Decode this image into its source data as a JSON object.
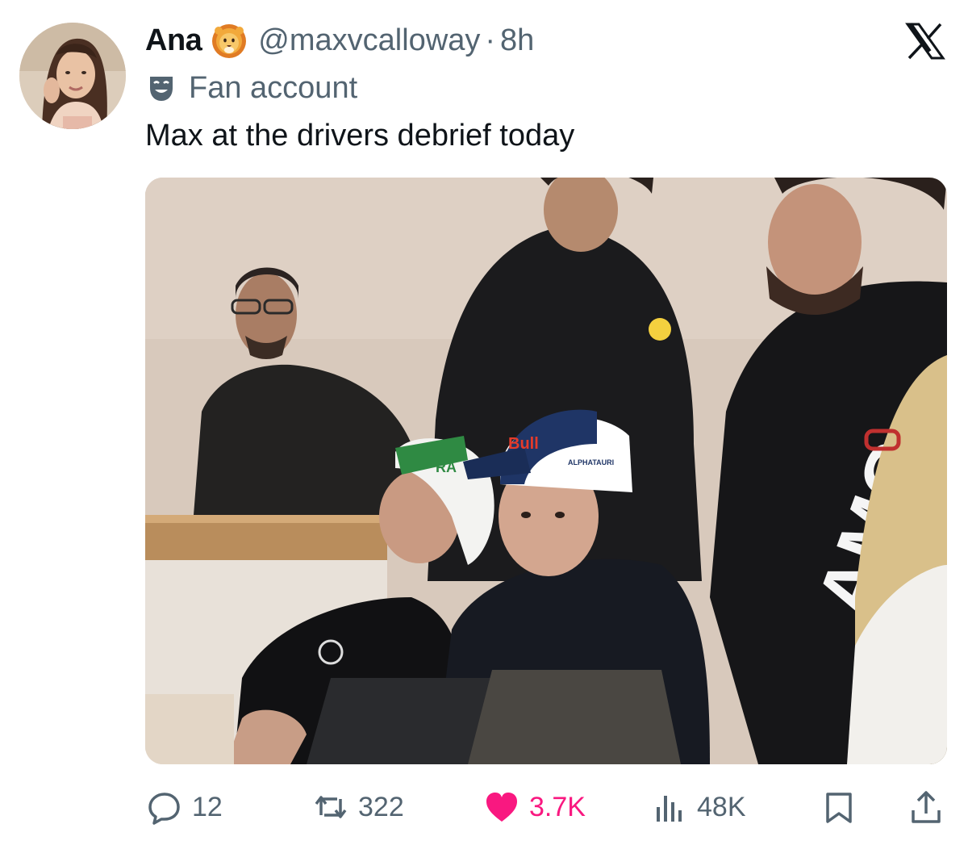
{
  "tweet": {
    "display_name": "Ana",
    "name_emoji": "lion-face-icon",
    "handle": "@maxvcalloway",
    "separator": "·",
    "time": "8h",
    "label_icon": "performing-arts-mask-icon",
    "label": "Fan account",
    "text": "Max at the drivers debrief today",
    "media_alt_icon": "photo",
    "media_caps": {
      "white_cap": "RA",
      "blue_cap_brand": "Bull",
      "blue_cap_team": "ALPHATAURI",
      "hoodie_logo": "AMG"
    }
  },
  "actions": {
    "reply": {
      "icon": "reply-bubble-icon",
      "count": "12"
    },
    "repost": {
      "icon": "repost-icon",
      "count": "322"
    },
    "like": {
      "icon": "heart-icon",
      "count": "3.7K",
      "liked": true,
      "color": "#f91880"
    },
    "views": {
      "icon": "views-bar-icon",
      "count": "48K"
    },
    "bookmark": {
      "icon": "bookmark-icon"
    },
    "share": {
      "icon": "share-icon"
    }
  },
  "colors": {
    "text": "#0f1419",
    "secondary": "#536471",
    "like": "#f91880"
  }
}
